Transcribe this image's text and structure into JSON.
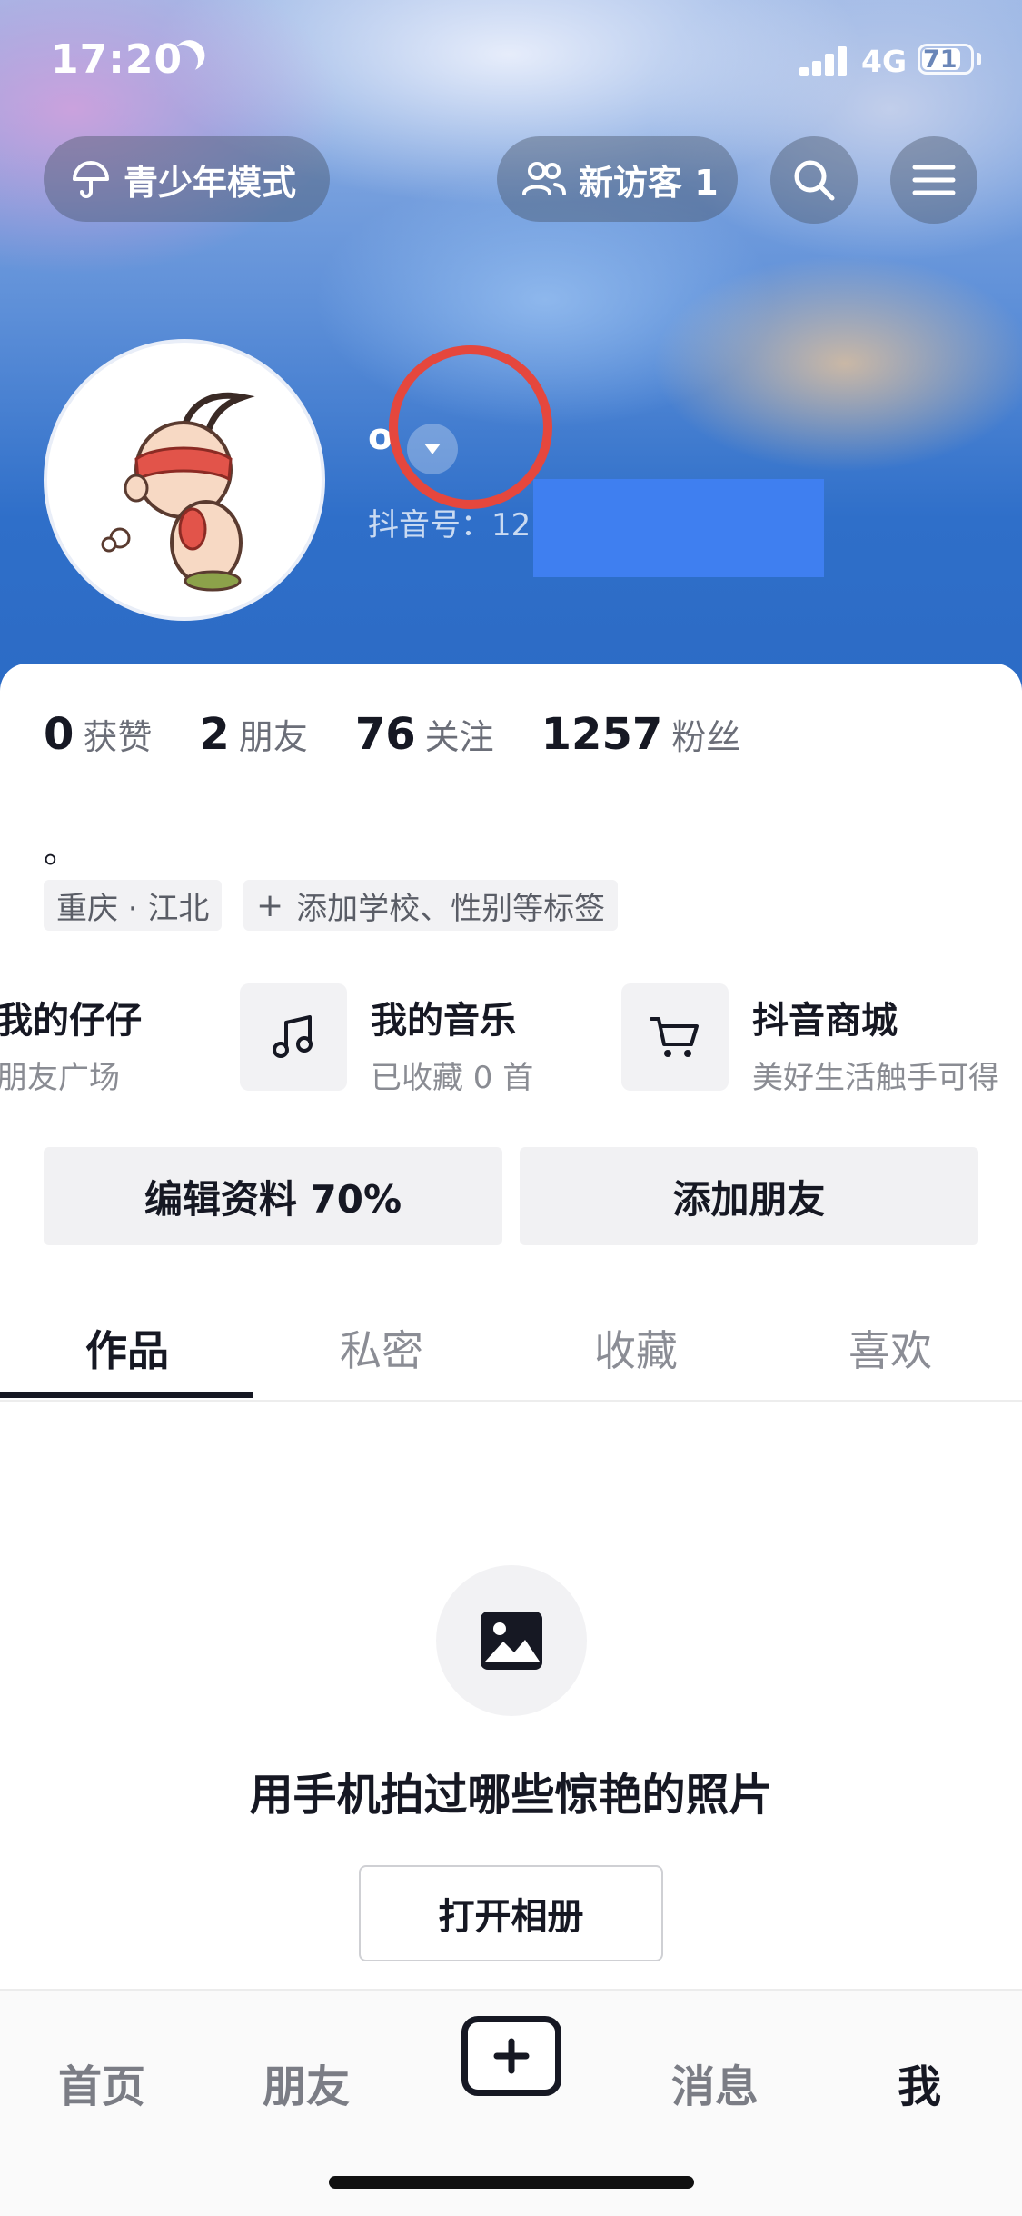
{
  "status_bar": {
    "time": "17:20",
    "network": "4G",
    "battery": "71"
  },
  "header": {
    "teen_mode_label": "青少年模式",
    "visitors_label": "新访客 1"
  },
  "profile": {
    "username": "o",
    "douyin_id_prefix": "抖音号：12"
  },
  "stats": [
    {
      "count": "0",
      "label": "获赞"
    },
    {
      "count": "2",
      "label": "朋友"
    },
    {
      "count": "76",
      "label": "关注"
    },
    {
      "count": "1257",
      "label": "粉丝"
    }
  ],
  "bio": "。",
  "tags": {
    "location": "重庆 · 江北",
    "add_tags": "添加学校、性别等标签"
  },
  "services": [
    {
      "title": "我的仔仔",
      "subtitle": "朋友广场",
      "icon": "pet-icon"
    },
    {
      "title": "我的音乐",
      "subtitle": "已收藏 0 首",
      "icon": "music-note-icon"
    },
    {
      "title": "抖音商城",
      "subtitle": "美好生活触手可得",
      "icon": "shopping-cart-icon"
    }
  ],
  "actions": {
    "edit_profile": "编辑资料 70%",
    "add_friends": "添加朋友"
  },
  "content_tabs": [
    {
      "label": "作品",
      "active": true
    },
    {
      "label": "私密",
      "active": false
    },
    {
      "label": "收藏",
      "active": false
    },
    {
      "label": "喜欢",
      "active": false
    }
  ],
  "empty_state": {
    "text": "用手机拍过哪些惊艳的照片",
    "button": "打开相册",
    "icon": "image-icon"
  },
  "bottom_nav": [
    {
      "label": "首页",
      "active": false
    },
    {
      "label": "朋友",
      "active": false
    },
    {
      "label": "消息",
      "active": false
    },
    {
      "label": "我",
      "active": true
    }
  ],
  "colors": {
    "accent_dark": "#161823",
    "annotation_circle": "#e5473d",
    "redaction": "#3f7ff0"
  }
}
